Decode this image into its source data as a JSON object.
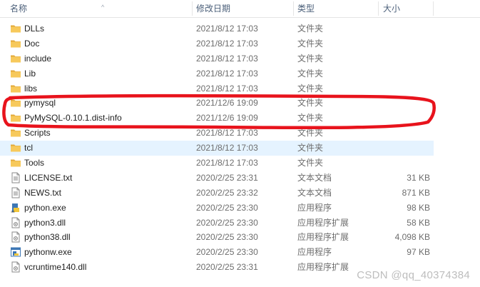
{
  "columns": {
    "name": "名称",
    "date": "修改日期",
    "type": "类型",
    "size": "大小"
  },
  "files": [
    {
      "name": "DLLs",
      "date": "2021/8/12 17:03",
      "type": "文件夹",
      "size": "",
      "icon": "folder-icon"
    },
    {
      "name": "Doc",
      "date": "2021/8/12 17:03",
      "type": "文件夹",
      "size": "",
      "icon": "folder-icon"
    },
    {
      "name": "include",
      "date": "2021/8/12 17:03",
      "type": "文件夹",
      "size": "",
      "icon": "folder-icon"
    },
    {
      "name": "Lib",
      "date": "2021/8/12 17:03",
      "type": "文件夹",
      "size": "",
      "icon": "folder-icon"
    },
    {
      "name": "libs",
      "date": "2021/8/12 17:03",
      "type": "文件夹",
      "size": "",
      "icon": "folder-icon"
    },
    {
      "name": "pymysql",
      "date": "2021/12/6 19:09",
      "type": "文件夹",
      "size": "",
      "icon": "folder-icon"
    },
    {
      "name": "PyMySQL-0.10.1.dist-info",
      "date": "2021/12/6 19:09",
      "type": "文件夹",
      "size": "",
      "icon": "folder-icon"
    },
    {
      "name": "Scripts",
      "date": "2021/8/12 17:03",
      "type": "文件夹",
      "size": "",
      "icon": "folder-icon"
    },
    {
      "name": "tcl",
      "date": "2021/8/12 17:03",
      "type": "文件夹",
      "size": "",
      "icon": "folder-icon",
      "selected": true
    },
    {
      "name": "Tools",
      "date": "2021/8/12 17:03",
      "type": "文件夹",
      "size": "",
      "icon": "folder-icon"
    },
    {
      "name": "LICENSE.txt",
      "date": "2020/2/25 23:31",
      "type": "文本文档",
      "size": "31 KB",
      "icon": "text-file-icon"
    },
    {
      "name": "NEWS.txt",
      "date": "2020/2/25 23:32",
      "type": "文本文档",
      "size": "871 KB",
      "icon": "text-file-icon"
    },
    {
      "name": "python.exe",
      "date": "2020/2/25 23:30",
      "type": "应用程序",
      "size": "98 KB",
      "icon": "python-exe-icon"
    },
    {
      "name": "python3.dll",
      "date": "2020/2/25 23:30",
      "type": "应用程序扩展",
      "size": "58 KB",
      "icon": "dll-file-icon"
    },
    {
      "name": "python38.dll",
      "date": "2020/2/25 23:30",
      "type": "应用程序扩展",
      "size": "4,098 KB",
      "icon": "dll-file-icon"
    },
    {
      "name": "pythonw.exe",
      "date": "2020/2/25 23:30",
      "type": "应用程序",
      "size": "97 KB",
      "icon": "pythonw-exe-icon"
    },
    {
      "name": "vcruntime140.dll",
      "date": "2020/2/25 23:31",
      "type": "应用程序扩展",
      "size": "",
      "icon": "dll-file-icon"
    }
  ],
  "colors": {
    "selected_row": "#e5f3ff",
    "folder": "#f5c24c",
    "annotation": "#e8131c"
  },
  "watermark": "CSDN @qq_40374384"
}
